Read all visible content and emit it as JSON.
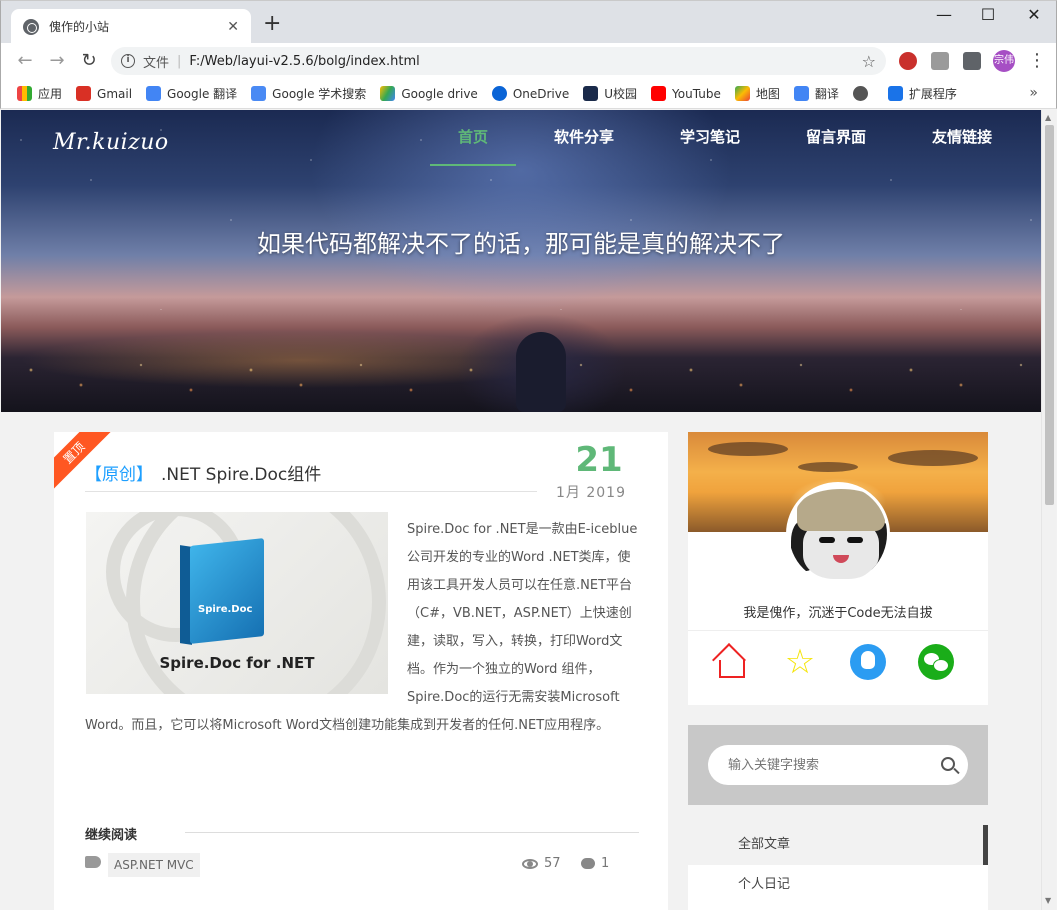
{
  "browser": {
    "tab_title": "傀作的小站",
    "address_label": "文件",
    "url": "F:/Web/layui-v2.5.6/bolg/index.html",
    "profile_badge": "宗伟",
    "bookmarks": [
      "应用",
      "Gmail",
      "Google 翻译",
      "Google 学术搜索",
      "Google drive",
      "OneDrive",
      "U校园",
      "YouTube",
      "地图",
      "翻译",
      "",
      "扩展程序"
    ]
  },
  "site": {
    "logo": "Mr.kuizuo",
    "nav": [
      "首页",
      "软件分享",
      "学习笔记",
      "留言界面",
      "友情链接"
    ],
    "slogan": "如果代码都解决不了的话，那可能是真的解决不了"
  },
  "article": {
    "ribbon": "置顶",
    "tag": "【原创】",
    "title": ".NET Spire.Doc组件",
    "day": "21",
    "month_year": "1月  2019",
    "thumb_caption": "Spire.Doc for .NET",
    "thumb_box_text": "Spire.Doc",
    "summary": "Spire.Doc for .NET是一款由E-iceblue公司开发的专业的Word .NET类库，使用该工具开发人员可以在任意.NET平台（C#，VB.NET，ASP.NET）上快速创建，读取，写入，转换，打印Word文档。作为一个独立的Word 组件，Spire.Doc的运行无需安装Microsoft Word。而且，它可以将Microsoft Word文档创建功能集成到开发者的任何.NET应用程序。",
    "read_more": "继续阅读",
    "tag_chip": "ASP.NET MVC",
    "views": "57",
    "comments": "1"
  },
  "sidebar": {
    "bio": "我是傀作，沉迷于Code无法自拔",
    "search_placeholder": "输入关键字搜索",
    "categories": [
      "全部文章",
      "个人日记"
    ]
  },
  "colors": {
    "accent": "#5fb878",
    "ribbon": "#ff5722",
    "tag": "#1e9fff"
  }
}
